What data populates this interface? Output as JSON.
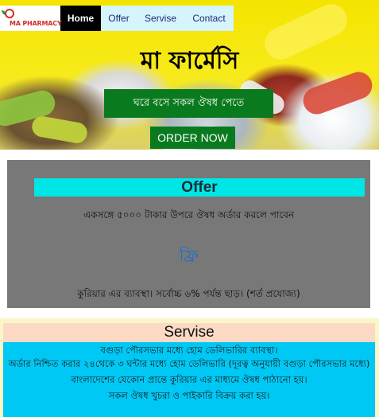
{
  "nav": {
    "logo_text": "MA PHARMACY",
    "items": [
      {
        "label": "Home",
        "active": true
      },
      {
        "label": "Offer",
        "active": false
      },
      {
        "label": "Servise",
        "active": false
      },
      {
        "label": "Contact",
        "active": false
      }
    ]
  },
  "hero": {
    "title": "মা ফার্মেসি",
    "tagline": "ঘরে বসে সকল ঔষধ পেতে",
    "order_button": "ORDER NOW"
  },
  "offer": {
    "heading": "Offer",
    "line1": "একসঙ্গে ৫০০০ টাকার উপরে ঔষধ অর্ডার করলে পাবেন",
    "free": "ফ্রি",
    "line2": "কুরিয়ার এর ব্যাবস্থা। সর্বোচ্চ ৬% পর্যন্ত ছাড়। (শর্ত প্রযোজ্য)"
  },
  "servise": {
    "heading": "Servise",
    "lines": [
      "বগুড়া পৌরসভার মধ্যে হোম ডেলিভারির ব্যাবস্থা।",
      "অর্ডার নিশ্চিত করার ২৪থেকে ৩ ঘন্টার মধ্যে হোম ডেলিভারি (দূরত্ব অনুযায়ী বগুড়া পৌরসভার মধ্যে)",
      "বাংলাদেশের যেকোন প্রান্তে কুরিয়ার এর মাধ্যমে ঔষধ পাঠানো হয়।",
      "সকল ঔষধ খুচরা ও পাইকারি বিক্রয় করা হয়।"
    ]
  },
  "colors": {
    "nav_active_bg": "#000000",
    "nav_bg": "#d6f4fb",
    "green_button": "#0a7a1e",
    "offer_bg": "#787878",
    "offer_heading_bg": "#00e5e5",
    "free_text": "#1f6fd1",
    "servise_heading_bg": "#fbd9c4",
    "servise_body_bg": "#00c8f5"
  }
}
